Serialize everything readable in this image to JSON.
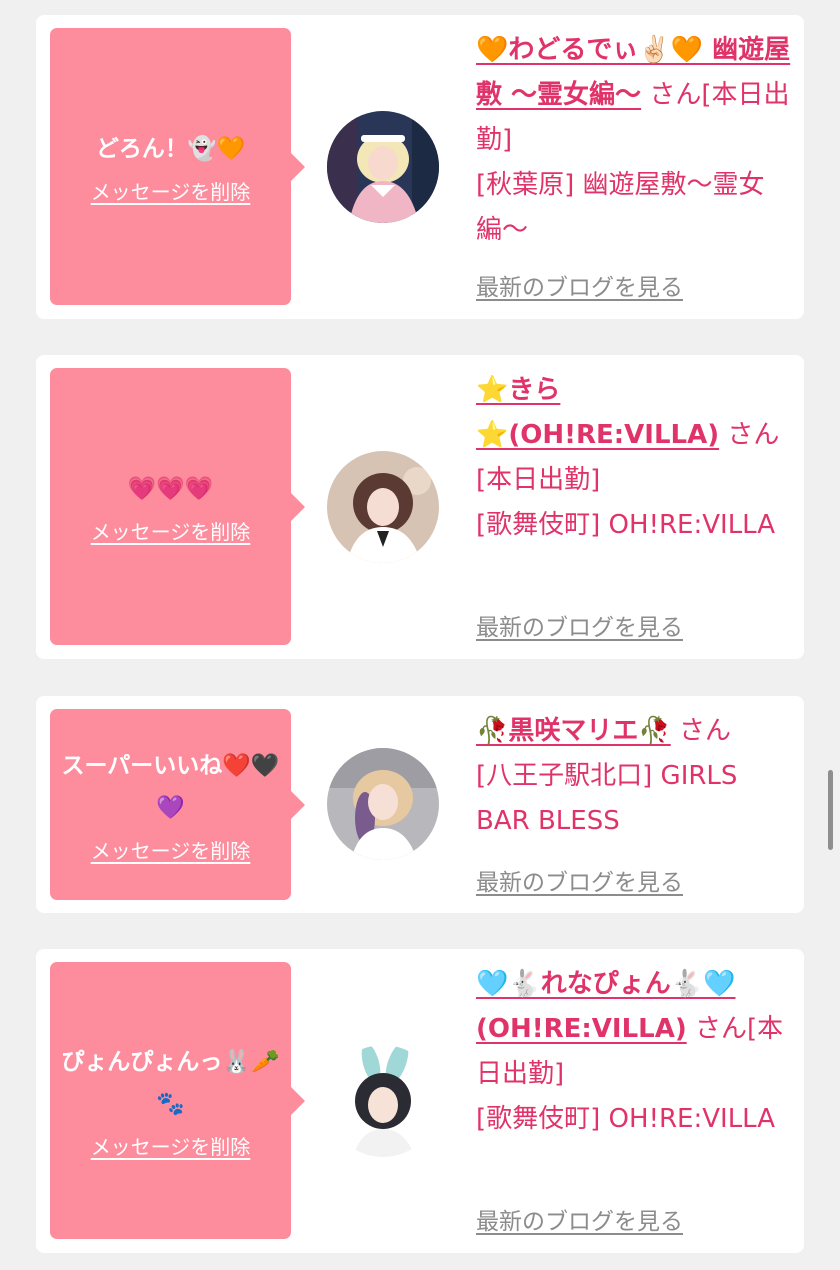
{
  "cards": [
    {
      "message": "どろん！👻🧡",
      "delete_label": "メッセージを削除",
      "name": "🧡わどるでぃ✌🏻🧡 幽遊屋敷 〜霊女編〜",
      "honorific": "さん",
      "status": "[本日出勤]",
      "location": "[秋葉原] 幽遊屋敷〜霊女編〜",
      "blog_label": "最新のブログを見る"
    },
    {
      "message": "💗💗💗",
      "delete_label": "メッセージを削除",
      "name": "⭐きら⭐(OH!RE:VILLA)",
      "honorific": "さん",
      "status": "[本日出勤]",
      "location": "[歌舞伎町] OH!RE:VILLA",
      "blog_label": "最新のブログを見る"
    },
    {
      "message": "スーパーいいね❤️🖤💜",
      "delete_label": "メッセージを削除",
      "name": "🥀黒咲マリエ🥀",
      "honorific": "さん",
      "status": "",
      "location": "[八王子駅北口] GIRLS BAR BLESS",
      "blog_label": "最新のブログを見る"
    },
    {
      "message": "ぴょんぴょんっ🐰🥕🐾",
      "delete_label": "メッセージを削除",
      "name": "🩵🐇れなぴょん🐇🩵(OH!RE:VILLA)",
      "honorific": "さん",
      "status": "[本日出勤]",
      "location": "[歌舞伎町] OH!RE:VILLA",
      "blog_label": "最新のブログを見る"
    }
  ],
  "colors": {
    "bubble": "#fd8c9d",
    "accent": "#e0336a",
    "muted": "#8c8c8c",
    "page_bg": "#f0f0f0"
  }
}
